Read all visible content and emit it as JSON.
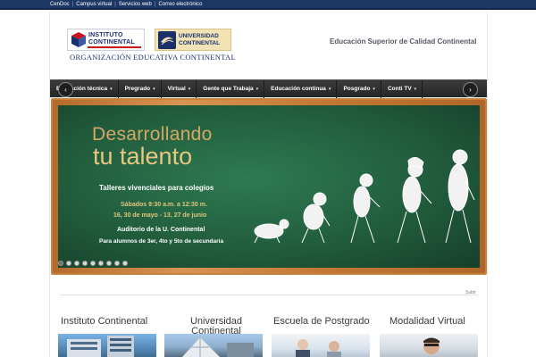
{
  "topbar": {
    "links": [
      "CenDoc",
      "Campus virtual",
      "Servicios web",
      "Correo electrónico"
    ],
    "separator": "|"
  },
  "header": {
    "logo_instituto": {
      "line1": "INSTITUTO",
      "line2": "CONTINENTAL"
    },
    "logo_universidad": {
      "line1": "UNIVERSIDAD",
      "line2": "CONTINENTAL"
    },
    "org_name": "ORGANIZACIÓN EDUCATIVA CONTINENTAL",
    "tagline": "Educación Superior de Calidad Continental"
  },
  "nav": {
    "items": [
      {
        "label": "Educación técnica",
        "caret": "▾"
      },
      {
        "label": "Pregrado",
        "caret": "▾"
      },
      {
        "label": "Virtual",
        "caret": "▾"
      },
      {
        "label": "Gente que Trabaja",
        "caret": "▾"
      },
      {
        "label": "Educación continua",
        "caret": "▾"
      },
      {
        "label": "Posgrado",
        "caret": "▾"
      },
      {
        "label": "Conti TV",
        "caret": "▾"
      }
    ]
  },
  "slider": {
    "title_line1": "Desarrollando",
    "title_line2": "tu talento",
    "subtitle": "Talleres vivenciales para colegios",
    "date_line1": "Sábados 9:30 a.m. a 12:30 m.",
    "date_line2": "16, 30 de mayo - 13, 27 de junio",
    "place": "Auditorio de la U. Continental",
    "audience": "Para alumnos de 3er, 4to y 5to de secundaria",
    "prev_icon": "‹",
    "next_icon": "›",
    "dots_total": 9,
    "active_dot": 0,
    "colors": {
      "title": "#d5a864",
      "board": "#215d3d",
      "frame": "#c47a36"
    }
  },
  "subir_label": "Subir",
  "sections": [
    {
      "title": "Instituto Continental"
    },
    {
      "title_line1": "Universidad",
      "title_line2": "Continental"
    },
    {
      "title": "Escuela de Postgrado"
    },
    {
      "title": "Modalidad Virtual"
    }
  ],
  "colors": {
    "topbar": "#1c3764",
    "navbar": "#2f2f2f",
    "brand_blue": "#1b2f6b"
  }
}
